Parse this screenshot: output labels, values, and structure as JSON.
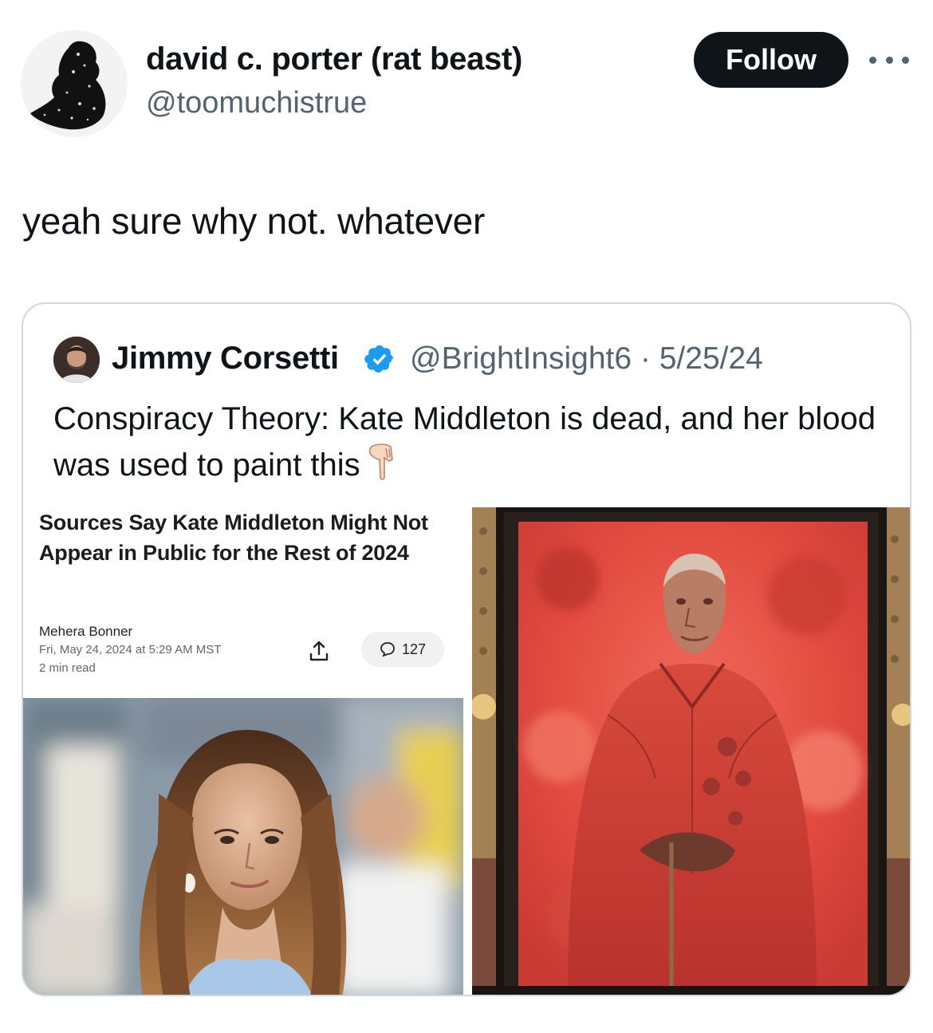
{
  "tweet": {
    "author": {
      "display_name": "david c. porter (rat beast)",
      "handle": "@toomuchistrue"
    },
    "follow_label": "Follow",
    "text": "yeah sure why not. whatever"
  },
  "quote": {
    "author": {
      "display_name": "Jimmy Corsetti",
      "handle_date": "@BrightInsight6 · 5/25/24"
    },
    "text": "Conspiracy Theory: Kate Middleton is dead, and her blood was used to paint this",
    "media": {
      "article": {
        "headline": "Sources Say Kate Middleton Might Not Appear in Public for the Rest of 2024",
        "author": "Mehera Bonner",
        "date": "Fri, May 24, 2024 at 5:29 AM MST",
        "read_time": "2 min read",
        "comments_count": "127"
      }
    }
  },
  "colors": {
    "accent_blue": "#1d9bf0",
    "text_primary": "#0f1419",
    "text_secondary": "#536471",
    "border": "#cfd9de"
  },
  "icons": [
    "more-icon",
    "verified-badge-icon",
    "pointing-down-emoji",
    "share-icon",
    "comment-icon"
  ]
}
